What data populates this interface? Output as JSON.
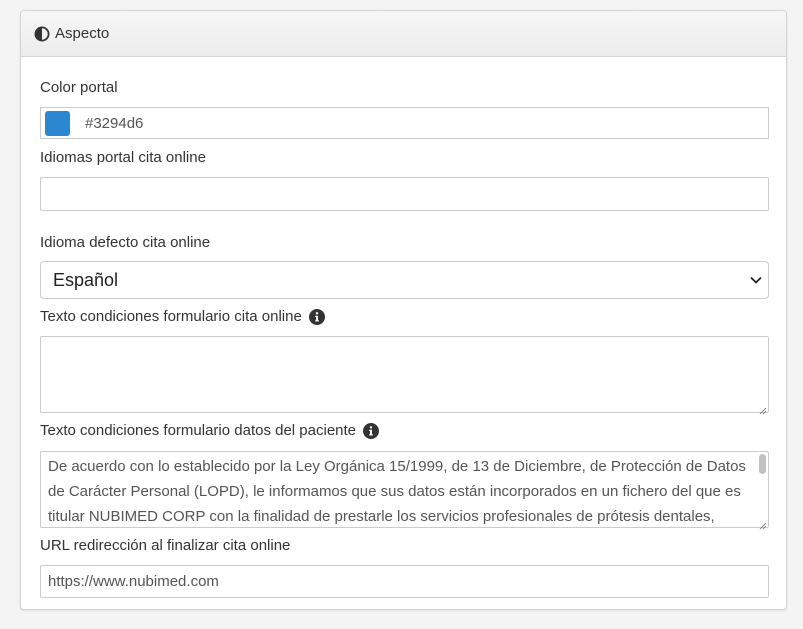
{
  "panel": {
    "title": "Aspecto",
    "icon": "adjust-icon"
  },
  "color_portal": {
    "label": "Color portal",
    "value": "#3294d6",
    "swatch_color": "#2a87d0"
  },
  "idiomas_portal": {
    "label": "Idiomas portal cita online",
    "value": ""
  },
  "idioma_defecto": {
    "label": "Idioma defecto cita online",
    "selected": "Español"
  },
  "texto_condiciones_cita": {
    "label": "Texto condiciones formulario cita online",
    "value": ""
  },
  "texto_condiciones_paciente": {
    "label": "Texto condiciones formulario datos del paciente",
    "lines": [
      "De acuerdo con lo establecido por la Ley Orgánica 15/1999, de 13 de Diciembre, de Protección de Datos",
      "de Carácter Personal (LOPD), le informamos que sus datos están incorporados en un fichero del que es",
      "titular NUBIMED CORP con la finalidad de prestarle los servicios profesionales de prótesis dentales,"
    ]
  },
  "url_redireccion": {
    "label": "URL redirección al finalizar cita online",
    "value": "https://www.nubimed.com"
  }
}
